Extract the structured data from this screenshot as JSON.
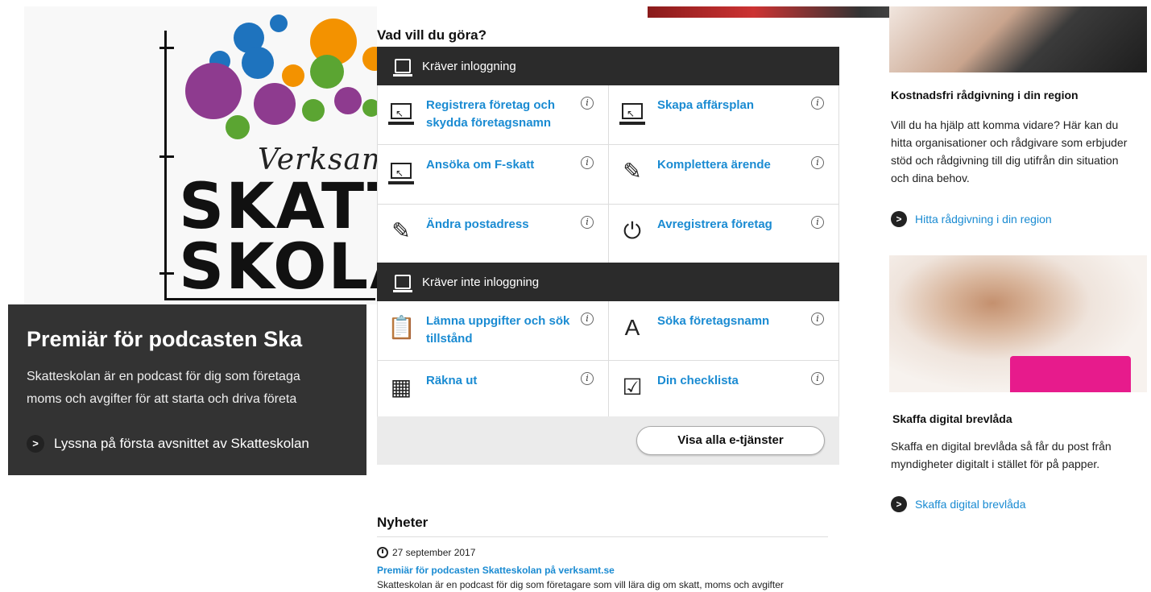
{
  "promo": {
    "logo_script": "Verksam",
    "logo_line1": "SKATT",
    "logo_line2": "SKOLA",
    "title": "Premiär för podcasten Ska",
    "text_line1": "Skatteskolan är en podcast för dig som företaga",
    "text_line2": "moms och avgifter för att starta och driva företa",
    "link": "Lyssna på första avsnittet av Skatteskolan"
  },
  "services": {
    "title": "Vad vill du göra?",
    "section_login": "Kräver inloggning",
    "section_nologin": "Kräver inte inloggning",
    "login_items": [
      {
        "label": "Registrera företag och skydda företagsnamn",
        "icon": "computer-icon"
      },
      {
        "label": "Skapa affärsplan",
        "icon": "computer-icon"
      },
      {
        "label": "Ansöka om F-skatt",
        "icon": "computer-icon"
      },
      {
        "label": "Komplettera ärende",
        "icon": "edit-icon"
      },
      {
        "label": "Ändra postadress",
        "icon": "edit-icon"
      },
      {
        "label": "Avregistrera företag",
        "icon": "power-icon"
      }
    ],
    "nologin_items": [
      {
        "label": "Lämna uppgifter och sök tillstånd",
        "icon": "clipboard-search-icon"
      },
      {
        "label": "Söka företagsnamn",
        "icon": "text-search-icon"
      },
      {
        "label": "Räkna ut",
        "icon": "calculator-icon"
      },
      {
        "label": "Din checklista",
        "icon": "checklist-icon"
      }
    ],
    "info_glyph": "i",
    "all_button": "Visa alla e-tjänster"
  },
  "news": {
    "title": "Nyheter",
    "date": "27 september 2017",
    "headline": "Premiär för podcasten Skatteskolan på verksamt.se",
    "excerpt": "Skatteskolan är en podcast för dig som företagare som vill lära dig om skatt, moms och avgifter"
  },
  "sidebar": {
    "block1": {
      "title": "Kostnadsfri rådgivning i din region",
      "text": "Vill du ha hjälp att komma vidare? Här kan du hitta organisationer och rådgivare som erbjuder stöd och rådgivning till dig utifrån din situation och dina behov.",
      "link": "Hitta rådgivning i din region"
    },
    "block2": {
      "title": "Skaffa digital brevlåda",
      "text": "Skaffa en digital brevlåda så får du post från myndigheter digitalt i stället för på papper.",
      "link": "Skaffa digital brevlåda"
    }
  },
  "colors": {
    "link_blue": "#1a8bd2",
    "dark_header": "#2b2b2b",
    "promo_box": "#333333"
  }
}
